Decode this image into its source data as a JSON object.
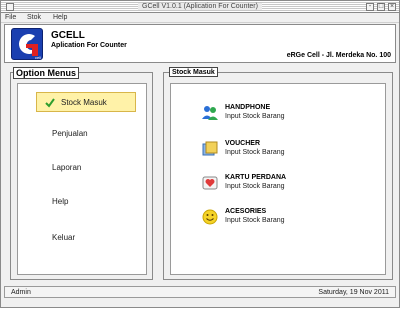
{
  "window": {
    "title": "GCell V1.0.1 (Aplication For Counter)"
  },
  "menu": {
    "items": [
      "File",
      "Stok",
      "Help"
    ]
  },
  "header": {
    "app_name": "GCELL",
    "app_subtitle": "Aplication For Counter",
    "address": "eRGe Cell - Jl. Merdeka No. 100"
  },
  "left_panel": {
    "title": "Option Menus",
    "items": [
      "Stock Masuk",
      "Penjualan",
      "Laporan",
      "Help",
      "Keluar"
    ],
    "active_index": 0
  },
  "right_panel": {
    "title": "Stock Masuk",
    "items": [
      {
        "title": "HANDPHONE",
        "subtitle": "Input Stock Barang",
        "icon": "users-icon"
      },
      {
        "title": "VOUCHER",
        "subtitle": "Input Stock Barang",
        "icon": "voucher-icon"
      },
      {
        "title": "KARTU PERDANA",
        "subtitle": "Input Stock Barang",
        "icon": "sim-card-icon"
      },
      {
        "title": "ACESORIES",
        "subtitle": "Input Stock Barang",
        "icon": "smiley-icon"
      }
    ]
  },
  "status": {
    "user": "Admin",
    "date": "Saturday, 19 Nov 2011"
  },
  "colors": {
    "active_highlight": "#fff2a8",
    "active_border": "#d8b64a",
    "logo_blue": "#1a3fb0"
  }
}
